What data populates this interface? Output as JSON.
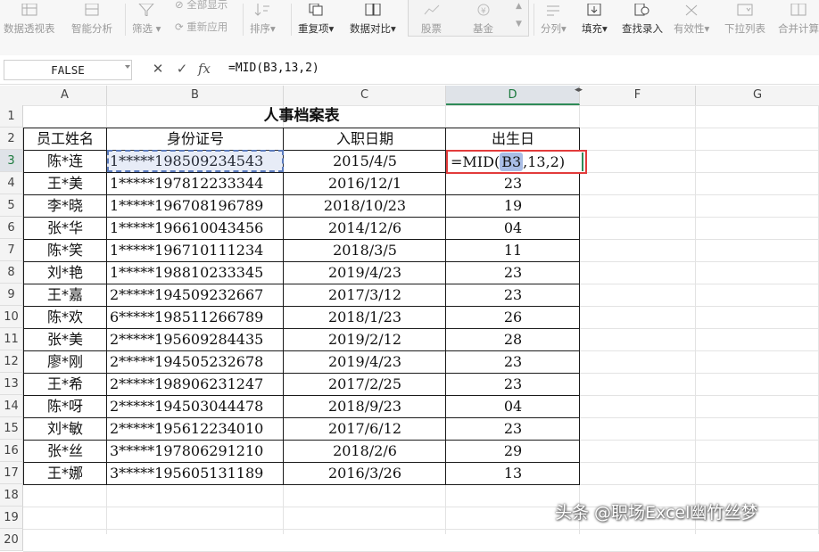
{
  "ribbon": {
    "items": [
      {
        "id": "pivot",
        "label": "数据透视表"
      },
      {
        "id": "smart",
        "label": "智能分析"
      },
      {
        "id": "filter",
        "label": "筛选"
      },
      {
        "id": "show_all",
        "label": "全部显示"
      },
      {
        "id": "reapply",
        "label": "重新应用"
      },
      {
        "id": "sort",
        "label": "排序"
      },
      {
        "id": "dup",
        "label": "重复项"
      },
      {
        "id": "compare",
        "label": "数据对比"
      },
      {
        "id": "stocks",
        "label": "股票"
      },
      {
        "id": "funds",
        "label": "基金"
      },
      {
        "id": "split",
        "label": "分列"
      },
      {
        "id": "fill",
        "label": "填充"
      },
      {
        "id": "lookup",
        "label": "查找录入"
      },
      {
        "id": "valid",
        "label": "有效性"
      },
      {
        "id": "dropdown",
        "label": "下拉列表"
      },
      {
        "id": "merge",
        "label": "合并计算"
      }
    ]
  },
  "formula_bar": {
    "name_box": "FALSE",
    "fx": "fx",
    "formula": "=MID(B3,13,2)"
  },
  "columns": [
    "A",
    "B",
    "C",
    "D",
    "F",
    "G"
  ],
  "rows": [
    "1",
    "2",
    "3",
    "4",
    "5",
    "6",
    "7",
    "8",
    "9",
    "10",
    "11",
    "12",
    "13",
    "14",
    "15",
    "16",
    "17",
    "18",
    "19",
    "20"
  ],
  "sheet": {
    "title": "人事档案表",
    "headers": [
      "员工姓名",
      "身份证号",
      "入职日期",
      "出生日"
    ],
    "edit_cell": {
      "prefix": "=MID(",
      "ref": "B3",
      "suffix": ",13,2)"
    },
    "records": [
      {
        "name": "陈*连",
        "id": "1*****198509234543",
        "date": "2015/4/5",
        "birth": ""
      },
      {
        "name": "王*美",
        "id": "1*****197812233344",
        "date": "2016/12/1",
        "birth": "23"
      },
      {
        "name": "李*晓",
        "id": "1*****196708196789",
        "date": "2018/10/23",
        "birth": "19"
      },
      {
        "name": "张*华",
        "id": "1*****196610043456",
        "date": "2014/12/6",
        "birth": "04"
      },
      {
        "name": "陈*笑",
        "id": "1*****196710111234",
        "date": "2018/3/5",
        "birth": "11"
      },
      {
        "name": "刘*艳",
        "id": "1*****198810233345",
        "date": "2019/4/23",
        "birth": "23"
      },
      {
        "name": "王*嘉",
        "id": "2*****194509232667",
        "date": "2017/3/12",
        "birth": "23"
      },
      {
        "name": "陈*欢",
        "id": "6*****198511266789",
        "date": "2018/1/23",
        "birth": "26"
      },
      {
        "name": "张*美",
        "id": "2*****195609284435",
        "date": "2019/2/12",
        "birth": "28"
      },
      {
        "name": "廖*刚",
        "id": "2*****194505232678",
        "date": "2019/4/23",
        "birth": "23"
      },
      {
        "name": "王*希",
        "id": "2*****198906231247",
        "date": "2017/2/25",
        "birth": "23"
      },
      {
        "name": "陈*呀",
        "id": "2*****194503044478",
        "date": "2018/9/23",
        "birth": "04"
      },
      {
        "name": "刘*敏",
        "id": "2*****195612234010",
        "date": "2017/6/12",
        "birth": "23"
      },
      {
        "name": "张*丝",
        "id": "3*****197806291210",
        "date": "2018/2/6",
        "birth": "29"
      },
      {
        "name": "王*娜",
        "id": "3*****195605131189",
        "date": "2016/3/26",
        "birth": "13"
      }
    ]
  },
  "active_cell": "D3",
  "watermark": "头条 @职场Excel幽竹丝梦",
  "colors": {
    "edit_border": "#e23b3b",
    "selection": "#5b7bbd",
    "active_header": "#2e8b57"
  }
}
